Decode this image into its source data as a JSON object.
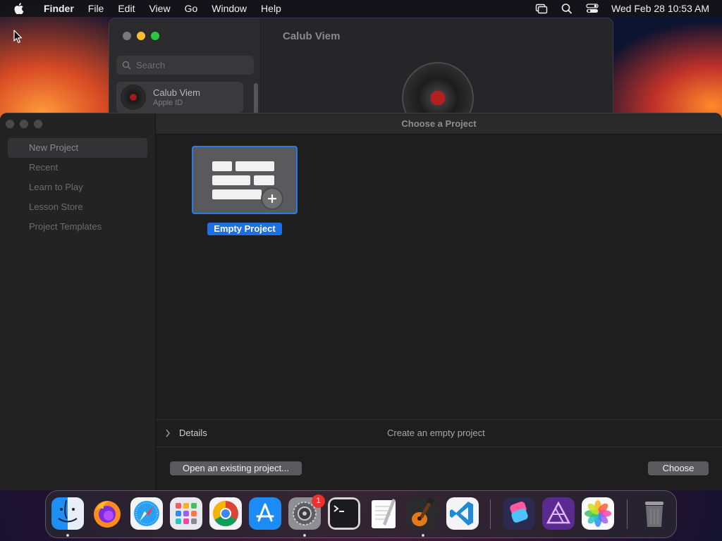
{
  "menubar": {
    "app_name": "Finder",
    "items": [
      "File",
      "Edit",
      "View",
      "Go",
      "Window",
      "Help"
    ],
    "clock": "Wed Feb 28  10:53 AM"
  },
  "background_window": {
    "search_placeholder": "Search",
    "account_name": "Calub Viem",
    "account_subtitle": "Apple ID",
    "title": "Calub Viem"
  },
  "dialog": {
    "title": "Choose a Project",
    "sidebar": [
      "New Project",
      "Recent",
      "Learn to Play",
      "Lesson Store",
      "Project Templates"
    ],
    "selected_sidebar": "New Project",
    "template_label": "Empty Project",
    "details_label": "Details",
    "details_description": "Create an empty project",
    "open_button": "Open an existing project...",
    "choose_button": "Choose"
  },
  "dock": {
    "apps": [
      "finder-icon",
      "firefox-icon",
      "safari-icon",
      "launchpad-icon",
      "chrome-icon",
      "app-store-icon",
      "system-settings-icon",
      "terminal-icon",
      "textedit-icon",
      "garageband-icon",
      "vscode-icon",
      "shortcuts-icon",
      "affinity-photo-icon",
      "photos-icon",
      "trash-icon"
    ],
    "settings_badge": "1"
  },
  "colors": {
    "accent": "#1d6fe3",
    "traffic_close": "#ff5f57",
    "traffic_min": "#febc2e",
    "traffic_max": "#28c840",
    "badge": "#e8322c"
  }
}
